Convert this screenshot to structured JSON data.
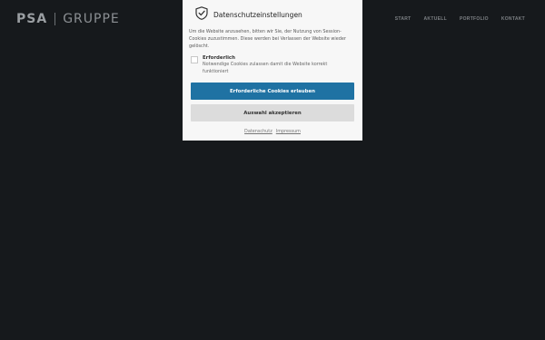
{
  "header": {
    "logo_bold": "PSA",
    "logo_light": "GRUPPE",
    "nav": [
      "START",
      "AKTUELL",
      "PORTFOLIO",
      "KONTAKT"
    ]
  },
  "dialog": {
    "icon": "shield-check-icon",
    "title": "Datenschutzeinstellungen",
    "text": "Um die Website anzusehen, bitten wir Sie, der Nutzung von Session-Cookies zuzustimmen. Diese werden bei Verlassen der Website wieder gelöscht.",
    "option": {
      "label": "Erforderlich",
      "description": "Notwendige Cookies zulassen damit die Website korrekt funktioniert",
      "checked": false
    },
    "primary_button": "Erforderliche Cookies erlauben",
    "secondary_button": "Auswahl akzeptieren",
    "links": [
      "Datenschutz",
      "Impressum"
    ]
  },
  "colors": {
    "background": "#16191c",
    "dialog_background": "#f7f7f7",
    "primary_button": "#1f72a3",
    "secondary_button": "#dcdcdc"
  }
}
